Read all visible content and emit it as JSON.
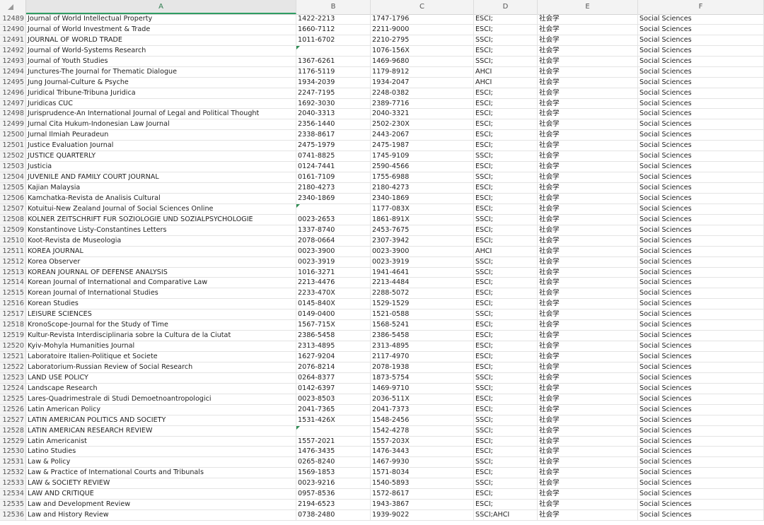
{
  "columns": [
    "A",
    "B",
    "C",
    "D",
    "E",
    "F"
  ],
  "rows": [
    {
      "n": "12489",
      "a": "Journal of World Intellectual Property",
      "b": "1422-2213",
      "c": "1747-1796",
      "d": "ESCI;",
      "e": "社会学",
      "f": "Social Sciences"
    },
    {
      "n": "12490",
      "a": "Journal of World Investment & Trade",
      "b": "1660-7112",
      "c": "2211-9000",
      "d": "ESCI;",
      "e": "社会学",
      "f": "Social Sciences"
    },
    {
      "n": "12491",
      "a": "JOURNAL OF WORLD TRADE",
      "b": "1011-6702",
      "c": "2210-2795",
      "d": "SSCI;",
      "e": "社会学",
      "f": "Social Sciences"
    },
    {
      "n": "12492",
      "a": "Journal of World-Systems Research",
      "b": "",
      "c": "1076-156X",
      "d": "ESCI;",
      "e": "社会学",
      "f": "Social Sciences",
      "flag": true
    },
    {
      "n": "12493",
      "a": "Journal of Youth Studies",
      "b": "1367-6261",
      "c": "1469-9680",
      "d": "SSCI;",
      "e": "社会学",
      "f": "Social Sciences"
    },
    {
      "n": "12494",
      "a": "Junctures-The Journal for Thematic Dialogue",
      "b": "1176-5119",
      "c": "1179-8912",
      "d": "AHCI",
      "e": "社会学",
      "f": "Social Sciences"
    },
    {
      "n": "12495",
      "a": "Jung Journal-Culture & Psyche",
      "b": "1934-2039",
      "c": "1934-2047",
      "d": "AHCI",
      "e": "社会学",
      "f": "Social Sciences"
    },
    {
      "n": "12496",
      "a": "Juridical Tribune-Tribuna Juridica",
      "b": "2247-7195",
      "c": "2248-0382",
      "d": "ESCI;",
      "e": "社会学",
      "f": "Social Sciences"
    },
    {
      "n": "12497",
      "a": "Juridicas CUC",
      "b": "1692-3030",
      "c": "2389-7716",
      "d": "ESCI;",
      "e": "社会学",
      "f": "Social Sciences"
    },
    {
      "n": "12498",
      "a": "Jurisprudence-An International Journal of Legal and Political Thought",
      "b": "2040-3313",
      "c": "2040-3321",
      "d": "ESCI;",
      "e": "社会学",
      "f": "Social Sciences"
    },
    {
      "n": "12499",
      "a": "Jurnal Cita Hukum-Indonesian Law Journal",
      "b": "2356-1440",
      "c": "2502-230X",
      "d": "ESCI;",
      "e": "社会学",
      "f": "Social Sciences"
    },
    {
      "n": "12500",
      "a": "Jurnal Ilmiah Peuradeun",
      "b": "2338-8617",
      "c": "2443-2067",
      "d": "ESCI;",
      "e": "社会学",
      "f": "Social Sciences"
    },
    {
      "n": "12501",
      "a": "Justice Evaluation Journal",
      "b": "2475-1979",
      "c": "2475-1987",
      "d": "ESCI;",
      "e": "社会学",
      "f": "Social Sciences"
    },
    {
      "n": "12502",
      "a": "JUSTICE QUARTERLY",
      "b": "0741-8825",
      "c": "1745-9109",
      "d": "SSCI;",
      "e": "社会学",
      "f": "Social Sciences"
    },
    {
      "n": "12503",
      "a": "Justicia",
      "b": "0124-7441",
      "c": "2590-4566",
      "d": "ESCI;",
      "e": "社会学",
      "f": "Social Sciences"
    },
    {
      "n": "12504",
      "a": "JUVENILE AND FAMILY COURT JOURNAL",
      "b": "0161-7109",
      "c": "1755-6988",
      "d": "SSCI;",
      "e": "社会学",
      "f": "Social Sciences"
    },
    {
      "n": "12505",
      "a": "Kajian Malaysia",
      "b": "2180-4273",
      "c": "2180-4273",
      "d": "ESCI;",
      "e": "社会学",
      "f": "Social Sciences"
    },
    {
      "n": "12506",
      "a": "Kamchatka-Revista de Analisis Cultural",
      "b": "2340-1869",
      "c": "2340-1869",
      "d": "ESCI;",
      "e": "社会学",
      "f": "Social Sciences"
    },
    {
      "n": "12507",
      "a": "Kotuitui-New Zealand Journal of Social Sciences Online",
      "b": "",
      "c": "1177-083X",
      "d": "ESCI;",
      "e": "社会学",
      "f": "Social Sciences",
      "flag": true
    },
    {
      "n": "12508",
      "a": "KOLNER ZEITSCHRIFT FUR SOZIOLOGIE UND SOZIALPSYCHOLOGIE",
      "b": "0023-2653",
      "c": "1861-891X",
      "d": "SSCI;",
      "e": "社会学",
      "f": "Social Sciences"
    },
    {
      "n": "12509",
      "a": "Konstantinove Listy-Constantines Letters",
      "b": "1337-8740",
      "c": "2453-7675",
      "d": "ESCI;",
      "e": "社会学",
      "f": "Social Sciences"
    },
    {
      "n": "12510",
      "a": "Koot-Revista de Museologia",
      "b": "2078-0664",
      "c": "2307-3942",
      "d": "ESCI;",
      "e": "社会学",
      "f": "Social Sciences"
    },
    {
      "n": "12511",
      "a": "KOREA JOURNAL",
      "b": "0023-3900",
      "c": "0023-3900",
      "d": "AHCI",
      "e": "社会学",
      "f": "Social Sciences"
    },
    {
      "n": "12512",
      "a": "Korea Observer",
      "b": "0023-3919",
      "c": "0023-3919",
      "d": "SSCI;",
      "e": "社会学",
      "f": "Social Sciences"
    },
    {
      "n": "12513",
      "a": "KOREAN JOURNAL OF DEFENSE ANALYSIS",
      "b": "1016-3271",
      "c": "1941-4641",
      "d": "SSCI;",
      "e": "社会学",
      "f": "Social Sciences"
    },
    {
      "n": "12514",
      "a": "Korean Journal of International and Comparative Law",
      "b": "2213-4476",
      "c": "2213-4484",
      "d": "ESCI;",
      "e": "社会学",
      "f": "Social Sciences"
    },
    {
      "n": "12515",
      "a": "Korean Journal of International Studies",
      "b": "2233-470X",
      "c": "2288-5072",
      "d": "ESCI;",
      "e": "社会学",
      "f": "Social Sciences"
    },
    {
      "n": "12516",
      "a": "Korean Studies",
      "b": "0145-840X",
      "c": "1529-1529",
      "d": "ESCI;",
      "e": "社会学",
      "f": "Social Sciences"
    },
    {
      "n": "12517",
      "a": "LEISURE SCIENCES",
      "b": "0149-0400",
      "c": "1521-0588",
      "d": "SSCI;",
      "e": "社会学",
      "f": "Social Sciences"
    },
    {
      "n": "12518",
      "a": "KronoScope-Journal for the Study of Time",
      "b": "1567-715X",
      "c": "1568-5241",
      "d": "ESCI;",
      "e": "社会学",
      "f": "Social Sciences"
    },
    {
      "n": "12519",
      "a": "Kultur-Revista Interdisciplinaria sobre la Cultura de la Ciutat",
      "b": "2386-5458",
      "c": "2386-5458",
      "d": "ESCI;",
      "e": "社会学",
      "f": "Social Sciences"
    },
    {
      "n": "12520",
      "a": "Kyiv-Mohyla Humanities Journal",
      "b": "2313-4895",
      "c": "2313-4895",
      "d": "ESCI;",
      "e": "社会学",
      "f": "Social Sciences"
    },
    {
      "n": "12521",
      "a": "Laboratoire Italien-Politique et Societe",
      "b": "1627-9204",
      "c": "2117-4970",
      "d": "ESCI;",
      "e": "社会学",
      "f": "Social Sciences"
    },
    {
      "n": "12522",
      "a": "Laboratorium-Russian Review of Social Research",
      "b": "2076-8214",
      "c": "2078-1938",
      "d": "ESCI;",
      "e": "社会学",
      "f": "Social Sciences"
    },
    {
      "n": "12523",
      "a": "LAND USE POLICY",
      "b": "0264-8377",
      "c": "1873-5754",
      "d": "SSCI;",
      "e": "社会学",
      "f": "Social Sciences"
    },
    {
      "n": "12524",
      "a": "Landscape Research",
      "b": "0142-6397",
      "c": "1469-9710",
      "d": "SSCI;",
      "e": "社会学",
      "f": "Social Sciences"
    },
    {
      "n": "12525",
      "a": "Lares-Quadrimestrale di Studi Demoetnoantropologici",
      "b": "0023-8503",
      "c": "2036-511X",
      "d": "ESCI;",
      "e": "社会学",
      "f": "Social Sciences"
    },
    {
      "n": "12526",
      "a": "Latin American Policy",
      "b": "2041-7365",
      "c": "2041-7373",
      "d": "ESCI;",
      "e": "社会学",
      "f": "Social Sciences"
    },
    {
      "n": "12527",
      "a": "LATIN AMERICAN POLITICS AND SOCIETY",
      "b": "1531-426X",
      "c": "1548-2456",
      "d": "SSCI;",
      "e": "社会学",
      "f": "Social Sciences"
    },
    {
      "n": "12528",
      "a": "LATIN AMERICAN RESEARCH REVIEW",
      "b": "",
      "c": "1542-4278",
      "d": "SSCI;",
      "e": "社会学",
      "f": "Social Sciences",
      "flag": true
    },
    {
      "n": "12529",
      "a": "Latin Americanist",
      "b": "1557-2021",
      "c": "1557-203X",
      "d": "ESCI;",
      "e": "社会学",
      "f": "Social Sciences"
    },
    {
      "n": "12530",
      "a": "Latino Studies",
      "b": "1476-3435",
      "c": "1476-3443",
      "d": "ESCI;",
      "e": "社会学",
      "f": "Social Sciences"
    },
    {
      "n": "12531",
      "a": "Law & Policy",
      "b": "0265-8240",
      "c": "1467-9930",
      "d": "SSCI;",
      "e": "社会学",
      "f": "Social Sciences"
    },
    {
      "n": "12532",
      "a": "Law & Practice of International Courts and Tribunals",
      "b": "1569-1853",
      "c": "1571-8034",
      "d": "ESCI;",
      "e": "社会学",
      "f": "Social Sciences"
    },
    {
      "n": "12533",
      "a": "LAW & SOCIETY REVIEW",
      "b": "0023-9216",
      "c": "1540-5893",
      "d": "SSCI;",
      "e": "社会学",
      "f": "Social Sciences"
    },
    {
      "n": "12534",
      "a": "LAW AND CRITIQUE",
      "b": "0957-8536",
      "c": "1572-8617",
      "d": "ESCI;",
      "e": "社会学",
      "f": "Social Sciences"
    },
    {
      "n": "12535",
      "a": "Law and Development Review",
      "b": "2194-6523",
      "c": "1943-3867",
      "d": "ESCI;",
      "e": "社会学",
      "f": "Social Sciences"
    },
    {
      "n": "12536",
      "a": "Law and History Review",
      "b": "0738-2480",
      "c": "1939-9022",
      "d": "SSCI;AHCI",
      "e": "社会学",
      "f": "Social Sciences"
    }
  ],
  "colors": {
    "selected_header": "#2f9d63",
    "error_flag": "#2d8c52"
  }
}
